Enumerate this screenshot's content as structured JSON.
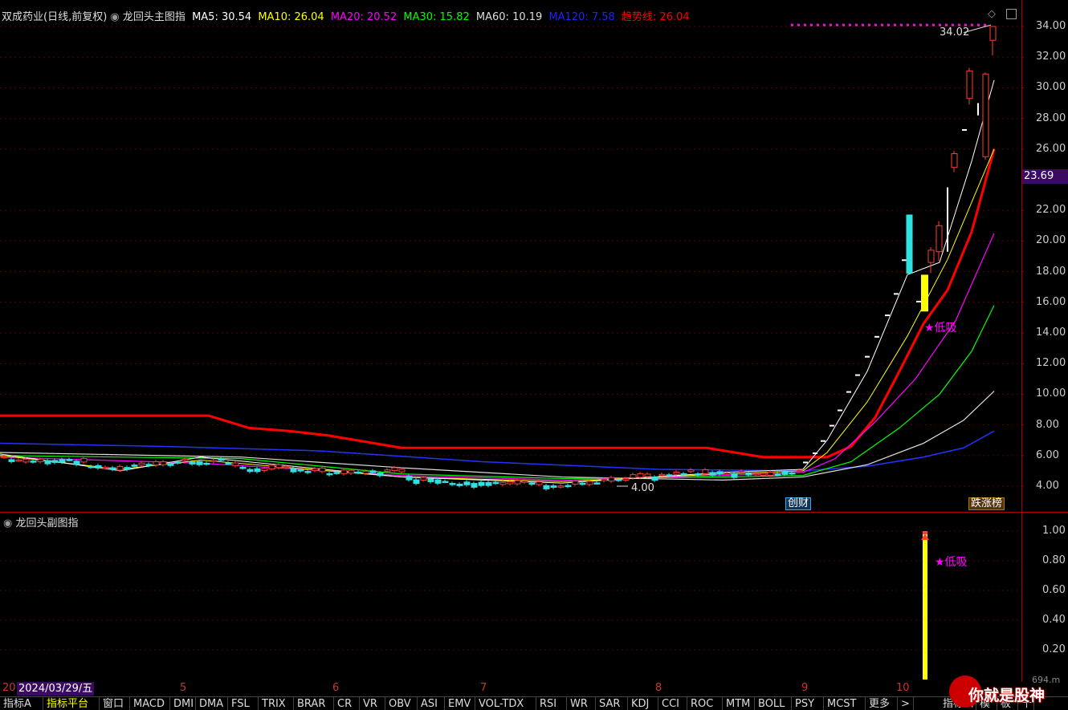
{
  "header": {
    "stock": "双成药业(日线,前复权)",
    "indicator": "龙回头主图指",
    "ma5": "MA5: 30.54",
    "ma10": "MA10: 26.04",
    "ma20": "MA20: 20.52",
    "ma30": "MA30: 15.82",
    "ma60": "MA60: 10.19",
    "ma120": "MA120: 7.58",
    "trend": "趋势线: 26.04"
  },
  "sub_header": {
    "indicator": "龙回头副图指"
  },
  "price_axis": [
    "34.00",
    "32.00",
    "30.00",
    "28.00",
    "26.00",
    "22.00",
    "20.00",
    "18.00",
    "16.00",
    "14.00",
    "12.00",
    "10.00",
    "8.00",
    "6.00",
    "4.00"
  ],
  "current_price": "23.69",
  "sub_axis": [
    "1.00",
    "0.80",
    "0.60",
    "0.40",
    "0.20"
  ],
  "annotations": {
    "high_label": "34.02",
    "low_label": "4.00",
    "buy_signal": "★低吸",
    "sub_buy_signal": "★低吸",
    "tag_finance": "财",
    "tag_finance_prefix": "创",
    "tag_rank": "涨榜",
    "tag_rank_prefix": "跌",
    "corner_value": "694.m"
  },
  "date_bar": {
    "start": "20",
    "date": "2024/03/29/五",
    "months": [
      "5",
      "6",
      "7",
      "8",
      "9",
      "10"
    ]
  },
  "tabs": [
    "指标A",
    "指标平台",
    "窗口",
    "MACD",
    "DMI",
    "DMA",
    "FSL",
    "TRIX",
    "BRAR",
    "CR",
    "VR",
    "OBV",
    "ASI",
    "EMV",
    "VOL-TDX",
    "RSI",
    "WR",
    "SAR",
    "KDJ",
    "CCI",
    "ROC",
    "MTM",
    "BOLL",
    "PSY",
    "MCST",
    "更多",
    ">"
  ],
  "right_tabs": [
    "指标口",
    "模",
    "板",
    "十"
  ],
  "watermark": "你就是股神",
  "colors": {
    "up": "#ff3b3b",
    "down": "#33e0e0",
    "ma5": "#ffffff",
    "ma10": "#ffff00",
    "ma20": "#ff00ff",
    "ma30": "#00ff00",
    "ma60": "#dddddd",
    "ma120": "#2233ff",
    "trend": "#ff0000",
    "signal_bar": "#ffff00"
  },
  "chart_data": {
    "type": "candlestick",
    "price_range": [
      3.2,
      35
    ],
    "ma5_last": 30.54,
    "ma10_last": 26.04,
    "ma20_last": 20.52,
    "ma30_last": 15.82,
    "ma60_last": 10.19,
    "ma120_last": 7.58,
    "trend_last": 26.04,
    "recent_candles": [
      {
        "o": 19.3,
        "c": 21.0,
        "h": 21.3,
        "l": 18.7,
        "up": true
      },
      {
        "o": 18.6,
        "c": 19.4,
        "h": 19.6,
        "l": 17.9,
        "up": true
      },
      {
        "o": 24.8,
        "c": 25.7,
        "h": 25.9,
        "l": 24.5,
        "up": true
      },
      {
        "o": 29.3,
        "c": 31.1,
        "h": 31.3,
        "l": 28.9,
        "up": true
      },
      {
        "o": 25.5,
        "c": 30.9,
        "h": 31.0,
        "l": 25.3,
        "up": true
      },
      {
        "o": 33.1,
        "c": 34.0,
        "h": 34.02,
        "l": 32.1,
        "up": true
      }
    ]
  }
}
